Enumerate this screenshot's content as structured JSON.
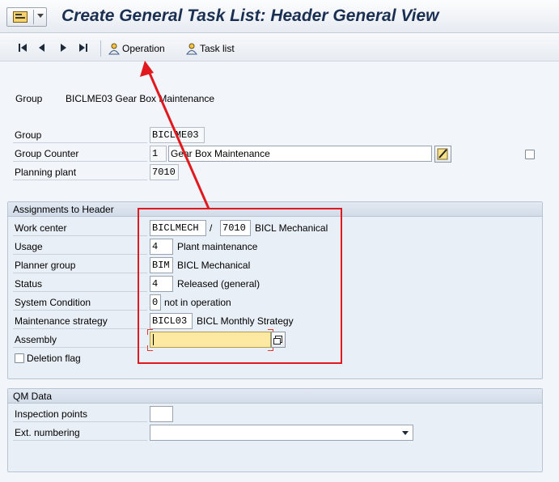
{
  "window": {
    "title": "Create General Task List: Header General View"
  },
  "toolbar": {
    "operation_label": "Operation",
    "task_list_label": "Task list"
  },
  "header": {
    "group_label": "Group",
    "group_value": "BICLME03 Gear Box Maintenance"
  },
  "fields": {
    "group_label": "Group",
    "group_value": "BICLME03",
    "group_counter_label": "Group Counter",
    "group_counter_value": "1",
    "group_counter_desc": "Gear Box Maintenance",
    "planning_plant_label": "Planning plant",
    "planning_plant_value": "7010"
  },
  "assignments": {
    "title": "Assignments to Header",
    "work_center_label": "Work center",
    "work_center_value": "BICLMECH",
    "work_center_sep": "/",
    "work_center_plant": "7010",
    "work_center_desc": "BICL Mechanical",
    "usage_label": "Usage",
    "usage_value": "4",
    "usage_desc": "Plant maintenance",
    "planner_group_label": "Planner group",
    "planner_group_value": "BIM",
    "planner_group_desc": "BICL Mechanical",
    "status_label": "Status",
    "status_value": "4",
    "status_desc": "Released (general)",
    "system_condition_label": "System Condition",
    "system_condition_value": "0",
    "system_condition_desc": "not in operation",
    "maintenance_strategy_label": "Maintenance strategy",
    "maintenance_strategy_value": "BICL03",
    "maintenance_strategy_desc": "BICL Monthly Strategy",
    "assembly_label": "Assembly",
    "assembly_value": "",
    "deletion_flag_label": "Deletion flag"
  },
  "qm": {
    "title": "QM Data",
    "inspection_points_label": "Inspection points",
    "inspection_points_value": "",
    "ext_numbering_label": "Ext. numbering",
    "ext_numbering_value": ""
  },
  "colors": {
    "annotation": "#e1191f",
    "focused_field": "#fde9a2",
    "title_text": "#1a2f52"
  }
}
